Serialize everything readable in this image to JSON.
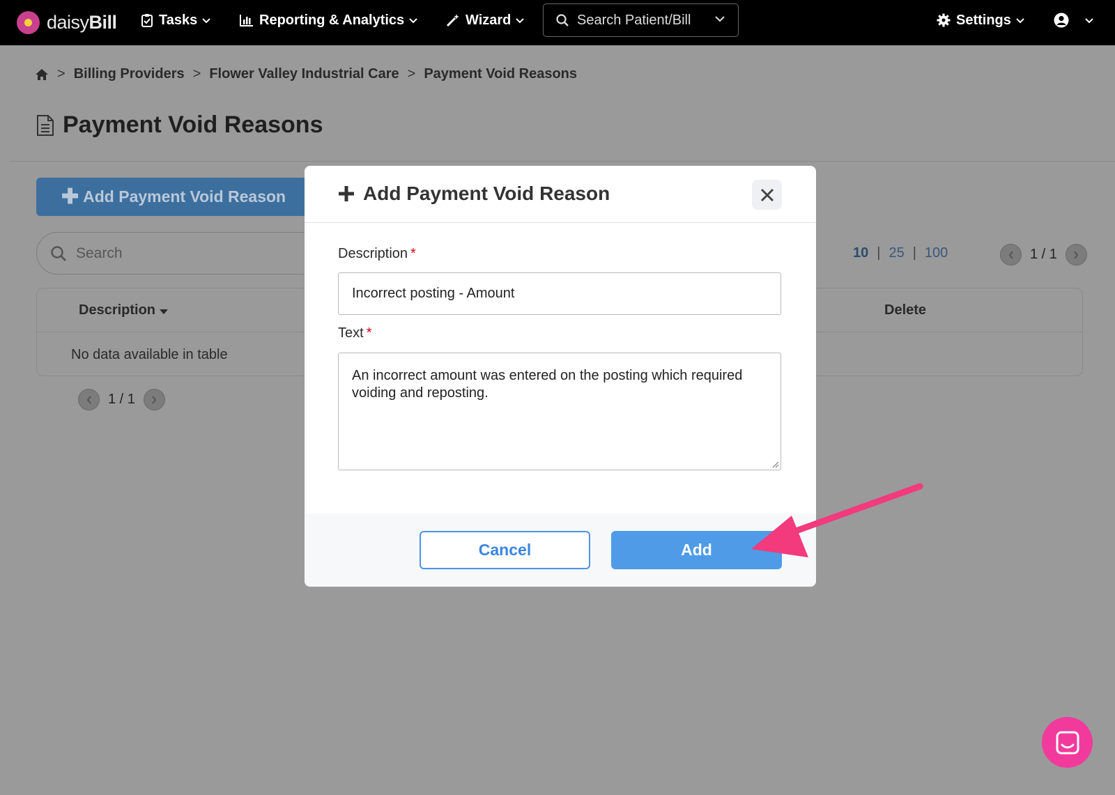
{
  "navbar": {
    "brand_prefix": "daisy",
    "brand_suffix": "Bill",
    "tasks": "Tasks",
    "reporting": "Reporting & Analytics",
    "wizard": "Wizard",
    "search_placeholder": "Search Patient/Bill",
    "settings": "Settings"
  },
  "breadcrumb": {
    "items": [
      "Billing Providers",
      "Flower Valley Industrial Care",
      "Payment Void Reasons"
    ],
    "separator": ">"
  },
  "page": {
    "title": "Payment Void Reasons",
    "add_button": "Add Payment Void Reason",
    "search_placeholder": "Search",
    "page_sizes": [
      "10",
      "25",
      "100"
    ],
    "pager": "1 / 1",
    "table": {
      "columns": [
        "Description",
        "Delete"
      ],
      "empty_text": "No data available in table"
    },
    "bottom_pager": "1 / 1"
  },
  "modal": {
    "title": "Add Payment Void Reason",
    "description_label": "Description",
    "description_value": "Incorrect posting - Amount",
    "text_label": "Text",
    "text_value": "An incorrect amount was entered on the posting which required voiding and reposting.",
    "required_mark": "*",
    "cancel_label": "Cancel",
    "add_label": "Add"
  },
  "colors": {
    "primary": "#4f9be8",
    "annotation_arrow": "#f23a7c",
    "chat": "#f23a9c"
  }
}
